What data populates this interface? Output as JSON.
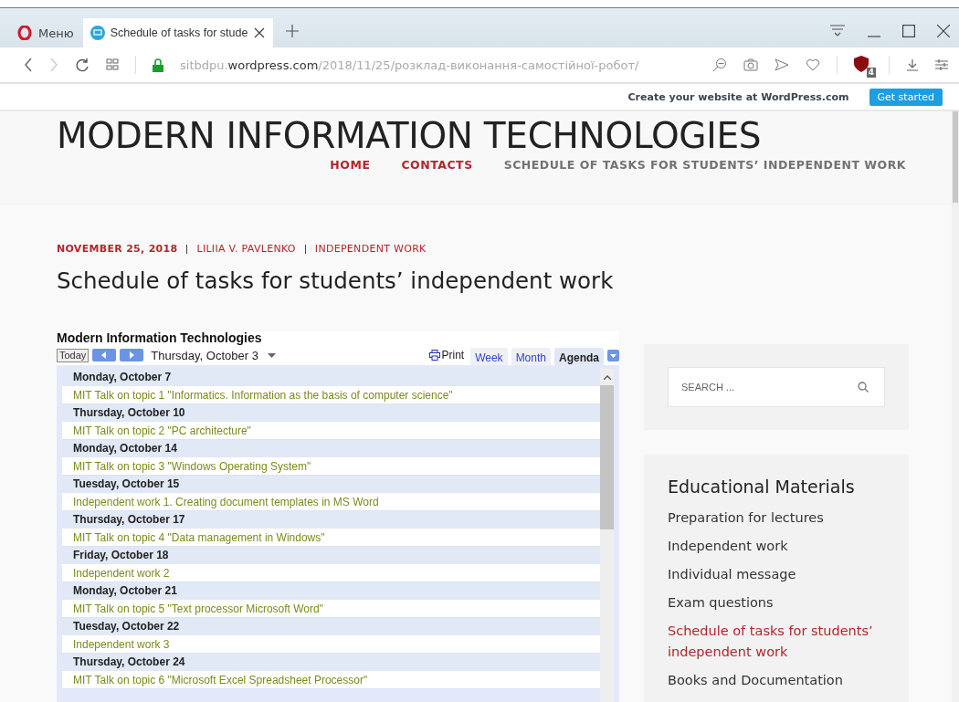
{
  "browser": {
    "menu_label": "Меню",
    "tabs": [
      {
        "title": "Schedule of tasks for stude",
        "selected": true
      }
    ],
    "url": {
      "subdomain": "sitbdpu.",
      "domain": "wordpress.com",
      "path": "/2018/11/25/розклад-виконання-самостійної-робот/"
    },
    "blocker_count": "4"
  },
  "wp_bar": {
    "text": "Create your website at WordPress.com",
    "button": "Get started"
  },
  "site": {
    "title": "MODERN INFORMATION TECHNOLOGIES",
    "nav": [
      {
        "label": "HOME",
        "selected": false
      },
      {
        "label": "CONTACTS",
        "selected": false
      },
      {
        "label": "SCHEDULE OF TASKS FOR STUDENTS’ INDEPENDENT WORK",
        "selected": true
      }
    ]
  },
  "post": {
    "date": "NOVEMBER 25, 2018",
    "author": "LILIIA V. PAVLENKO",
    "category": "INDEPENDENT WORK",
    "title": "Schedule of tasks for students’ independent work"
  },
  "calendar": {
    "title": "Modern Information Technologies",
    "today": "Today",
    "current_date": "Thursday, October 3",
    "print": "Print",
    "views": [
      {
        "label": "Week",
        "selected": false
      },
      {
        "label": "Month",
        "selected": false
      },
      {
        "label": "Agenda",
        "selected": true
      }
    ],
    "agenda": [
      {
        "date": "Monday, October 7",
        "events": [
          "MIT Talk on topic 1 \"Informatics. Information as the basis of computer science\""
        ]
      },
      {
        "date": "Thursday, October 10",
        "events": [
          "MIT Talk on topic 2 \"PC architecture\""
        ]
      },
      {
        "date": "Monday, October 14",
        "events": [
          "MIT Talk on topic 3 \"Windows Operating System\""
        ]
      },
      {
        "date": "Tuesday, October 15",
        "events": [
          "Independent work 1. Creating document templates in MS Word"
        ]
      },
      {
        "date": "Thursday, October 17",
        "events": [
          "MIT Talk on topic 4 \"Data management in Windows\""
        ]
      },
      {
        "date": "Friday, October 18",
        "events": [
          "Independent work 2"
        ]
      },
      {
        "date": "Monday, October 21",
        "events": [
          "MIT Talk on topic 5 \"Text processor Microsoft Word\""
        ]
      },
      {
        "date": "Tuesday, October 22",
        "events": [
          "Independent work 3"
        ]
      },
      {
        "date": "Thursday, October 24",
        "events": [
          "MIT Talk on topic 6 \"Microsoft Excel Spreadsheet Processor\""
        ]
      }
    ]
  },
  "sidebar": {
    "search": {
      "placeholder": "SEARCH ..."
    },
    "widget_title": "Educational Materials",
    "items": [
      {
        "label": "Preparation for lectures",
        "selected": false
      },
      {
        "label": "Independent work",
        "selected": false
      },
      {
        "label": "Individual message",
        "selected": false
      },
      {
        "label": "Exam questions",
        "selected": false
      },
      {
        "label": "Schedule of tasks for students’ independent work",
        "selected": true
      },
      {
        "label": "Books and Documentation",
        "selected": false
      }
    ]
  }
}
